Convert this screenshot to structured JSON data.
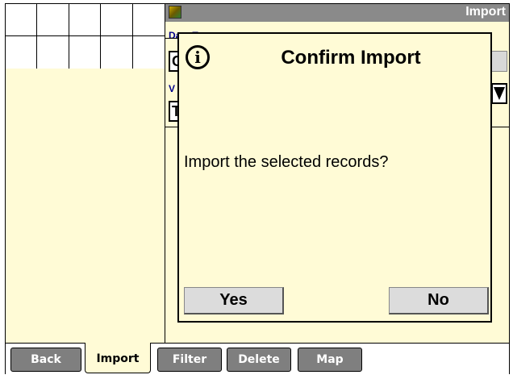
{
  "header": {
    "title": "Import"
  },
  "form": {
    "data_type_label": "Data Type",
    "data_type_value": "C",
    "second_label": "V",
    "second_value": "T"
  },
  "dialog": {
    "title": "Confirm Import",
    "message": "Import the selected records?",
    "yes_label": "Yes",
    "no_label": "No"
  },
  "tabs": [
    {
      "label": "Back",
      "active": false
    },
    {
      "label": "Import",
      "active": true
    },
    {
      "label": "Filter",
      "active": false
    },
    {
      "label": "Delete",
      "active": false
    },
    {
      "label": "Map",
      "active": false
    }
  ],
  "colors": {
    "panel": "#fffbd6",
    "titlebar": "#8a8a8a",
    "tab": "#7f7f7f"
  },
  "icons": {
    "dialog": "info-icon",
    "dropdown": "chevron-down-icon"
  }
}
